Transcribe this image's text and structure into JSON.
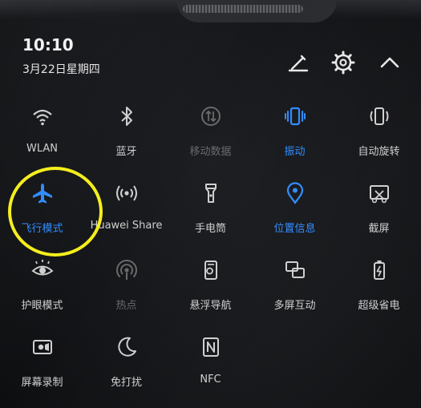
{
  "status": {
    "time": "10:10",
    "date": "3月22日星期四"
  },
  "header_icons": [
    "edit-icon",
    "settings-icon",
    "collapse-icon"
  ],
  "colors": {
    "active": "#2f8cff",
    "inactive": "#cfcfcf",
    "dim": "#6a6a6a",
    "highlight_ring": "#f5ee1b"
  },
  "tiles": [
    {
      "label": "WLAN",
      "icon": "wifi-icon",
      "state": "inactive"
    },
    {
      "label": "蓝牙",
      "icon": "bluetooth-icon",
      "state": "inactive"
    },
    {
      "label": "移动数据",
      "icon": "mobile-data-icon",
      "state": "dim"
    },
    {
      "label": "振动",
      "icon": "vibrate-icon",
      "state": "active"
    },
    {
      "label": "自动旋转",
      "icon": "auto-rotate-icon",
      "state": "inactive"
    },
    {
      "label": "飞行模式",
      "icon": "airplane-icon",
      "state": "active"
    },
    {
      "label": "Huawei Share",
      "icon": "huawei-share-icon",
      "state": "inactive"
    },
    {
      "label": "手电筒",
      "icon": "flashlight-icon",
      "state": "inactive"
    },
    {
      "label": "位置信息",
      "icon": "location-icon",
      "state": "active"
    },
    {
      "label": "截屏",
      "icon": "screenshot-icon",
      "state": "inactive"
    },
    {
      "label": "护眼模式",
      "icon": "eye-comfort-icon",
      "state": "inactive"
    },
    {
      "label": "热点",
      "icon": "hotspot-icon",
      "state": "dim"
    },
    {
      "label": "悬浮导航",
      "icon": "floating-nav-icon",
      "state": "inactive"
    },
    {
      "label": "多屏互动",
      "icon": "multi-screen-icon",
      "state": "inactive"
    },
    {
      "label": "超级省电",
      "icon": "battery-saver-icon",
      "state": "inactive"
    },
    {
      "label": "屏幕录制",
      "icon": "screen-record-icon",
      "state": "inactive"
    },
    {
      "label": "免打扰",
      "icon": "do-not-disturb-icon",
      "state": "inactive"
    },
    {
      "label": "NFC",
      "icon": "nfc-icon",
      "state": "inactive"
    }
  ]
}
